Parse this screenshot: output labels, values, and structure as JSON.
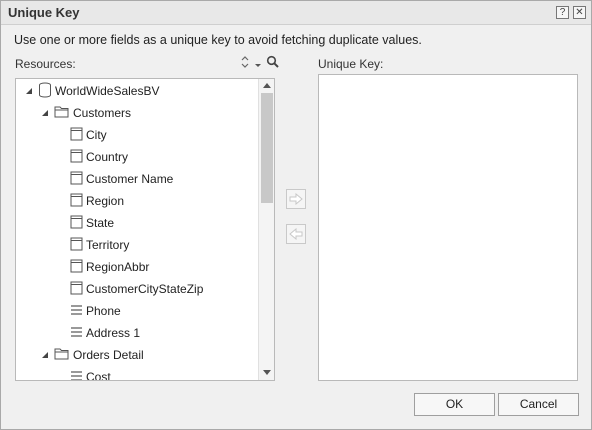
{
  "dialog": {
    "title": "Unique Key",
    "help_label": "?",
    "close_label": "✕",
    "description": "Use one or more fields as a unique key to avoid fetching duplicate values."
  },
  "resources": {
    "label": "Resources:",
    "tree": [
      {
        "label": "WorldWideSalesBV",
        "level": 0,
        "icon": "database-icon",
        "expanded": true
      },
      {
        "label": "Customers",
        "level": 1,
        "icon": "folder-icon",
        "expanded": true
      },
      {
        "label": "City",
        "level": 2,
        "icon": "field-icon"
      },
      {
        "label": "Country",
        "level": 2,
        "icon": "field-icon"
      },
      {
        "label": "Customer Name",
        "level": 2,
        "icon": "field-icon"
      },
      {
        "label": "Region",
        "level": 2,
        "icon": "field-icon"
      },
      {
        "label": "State",
        "level": 2,
        "icon": "field-icon"
      },
      {
        "label": "Territory",
        "level": 2,
        "icon": "field-icon"
      },
      {
        "label": "RegionAbbr",
        "level": 2,
        "icon": "field-icon"
      },
      {
        "label": "CustomerCityStateZip",
        "level": 2,
        "icon": "field-icon"
      },
      {
        "label": "Phone",
        "level": 2,
        "icon": "detail-field-icon"
      },
      {
        "label": "Address 1",
        "level": 2,
        "icon": "detail-field-icon"
      },
      {
        "label": "Orders Detail",
        "level": 1,
        "icon": "folder-icon",
        "expanded": true
      },
      {
        "label": "Cost",
        "level": 2,
        "icon": "detail-field-icon"
      }
    ]
  },
  "unique_key": {
    "label": "Unique Key:"
  },
  "buttons": {
    "ok": "OK",
    "cancel": "Cancel"
  }
}
